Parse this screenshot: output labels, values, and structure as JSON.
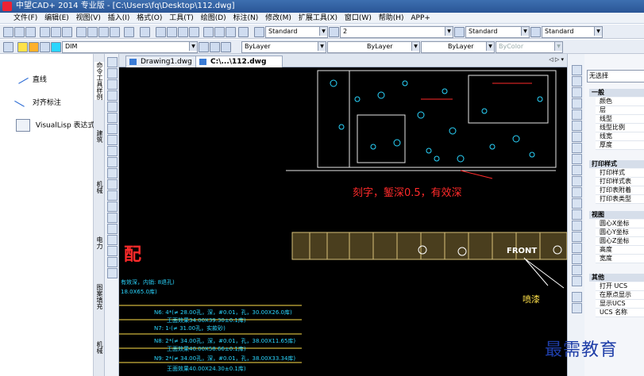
{
  "title": "中望CAD+ 2014 专业版 - [C:\\Users\\fq\\Desktop\\112.dwg]",
  "menu": [
    "文件(F)",
    "编辑(E)",
    "视图(V)",
    "插入(I)",
    "格式(O)",
    "工具(T)",
    "绘图(D)",
    "标注(N)",
    "修改(M)",
    "扩展工具(X)",
    "窗口(W)",
    "帮助(H)",
    "APP+"
  ],
  "toolbar1": {
    "text_style": "Standard",
    "dim_style": "2",
    "table_style": "Standard",
    "multileader_style": "Standard"
  },
  "toolbar2": {
    "layer": "DIM",
    "color": "ByLayer",
    "linetype": "ByLayer",
    "lineweight": "ByLayer",
    "plotstyle": "ByColor"
  },
  "left_panel": {
    "items": [
      "直线",
      "对齐标注",
      "VisualLisp 表达式"
    ]
  },
  "left_vtabs": [
    "命令工具样例",
    "建筑",
    "机械",
    "电力",
    "图案填充",
    "机械"
  ],
  "doc_tabs": [
    "Drawing1.dwg",
    "C:\\...\\112.dwg"
  ],
  "canvas": {
    "note_red": "刻字，錾深0.5，有效深",
    "big_red": "配",
    "front_label": "FRONT",
    "yellow_label": "喷漆",
    "list_lines": [
      "有效深，内销: 8退孔)",
      "18.0X65.0库)",
      "N6: 4*(≠ 28.00孔，深，#0.01，孔，30.00X26.0库)",
      "王面效果34.00X39.30±0.1库)",
      "N7: 1-(≠ 31.00孔，实款砂)",
      "N8: 2*(≠ 34.00孔，深，#0.01，孔，38.00X11.65库)",
      "王面效果40.00X58.66±0.1库)",
      "N9: 2*(≠ 34.00孔，深，#0.01，孔，38.00X33.34库)",
      "王面效果40.00X24.30±0.1库)"
    ]
  },
  "properties": {
    "selection": "无选择",
    "groups": [
      {
        "name": "一般",
        "rows": [
          "颜色",
          "层",
          "线型",
          "线型比例",
          "线宽",
          "厚度"
        ]
      },
      {
        "name": "打印样式",
        "rows": [
          "打印样式",
          "打印样式表",
          "打印表附着",
          "打印表类型"
        ]
      },
      {
        "name": "视图",
        "rows": [
          "圆心X坐标",
          "圆心Y坐标",
          "圆心Z坐标",
          "高度",
          "宽度"
        ]
      },
      {
        "name": "其他",
        "rows": [
          "打开 UCS",
          "在原点显示",
          "显示UCS",
          "UCS 名称"
        ]
      }
    ]
  },
  "watermark": "最需教育"
}
